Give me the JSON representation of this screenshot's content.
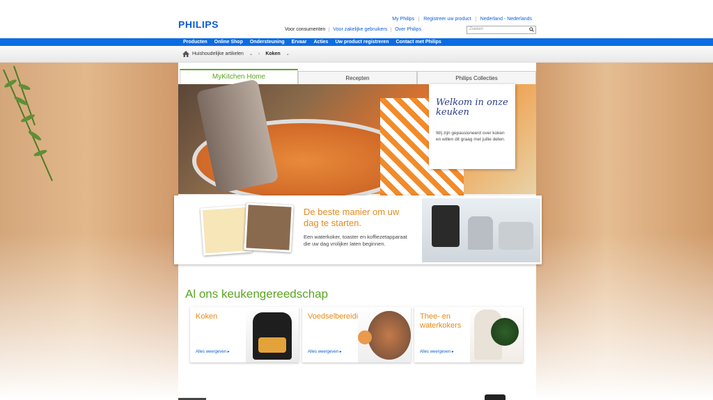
{
  "header": {
    "logo": "PHILIPS",
    "top_links": [
      "My Philips",
      "Registreer uw product",
      "Nederland - Nederlands"
    ],
    "segments": [
      "Voor consumenten",
      "Voor zakelijke gebruikers",
      "Over Philips"
    ],
    "search_placeholder": "Zoeken"
  },
  "nav": [
    "Producten",
    "Online Shop",
    "Ondersteuning",
    "Ervaar",
    "Acties",
    "Uw product registreren",
    "Contact met Philips"
  ],
  "breadcrumb": {
    "item1": "Huishoudelijke artikelen",
    "item2": "Koken"
  },
  "tabs": [
    "MyKitchen Home",
    "Recepten",
    "Philips Collecties"
  ],
  "hero_note": {
    "title": "Welkom in onze keuken",
    "text": "Wij zijn gepassioneerd over koken en willen dit graag met jullie delen."
  },
  "promo": {
    "title": "De beste manier om uw dag te starten.",
    "text": "Een waterkoker, toaster en koffiezetapparaat die uw dag vrolijker laten beginnen."
  },
  "section_title": "Al ons keukengereedschap",
  "cards": [
    {
      "title": "Koken",
      "more": "Alles weergeven"
    },
    {
      "title": "Voedselbereiding",
      "more": "Alles weergeven"
    },
    {
      "title": "Thee- en waterkokers",
      "more": "Alles weergeven"
    }
  ],
  "colors": {
    "brand_blue": "#0b5ed7",
    "nav_blue": "#0b6ce3",
    "green": "#5aa61f",
    "orange": "#e58a1a"
  }
}
